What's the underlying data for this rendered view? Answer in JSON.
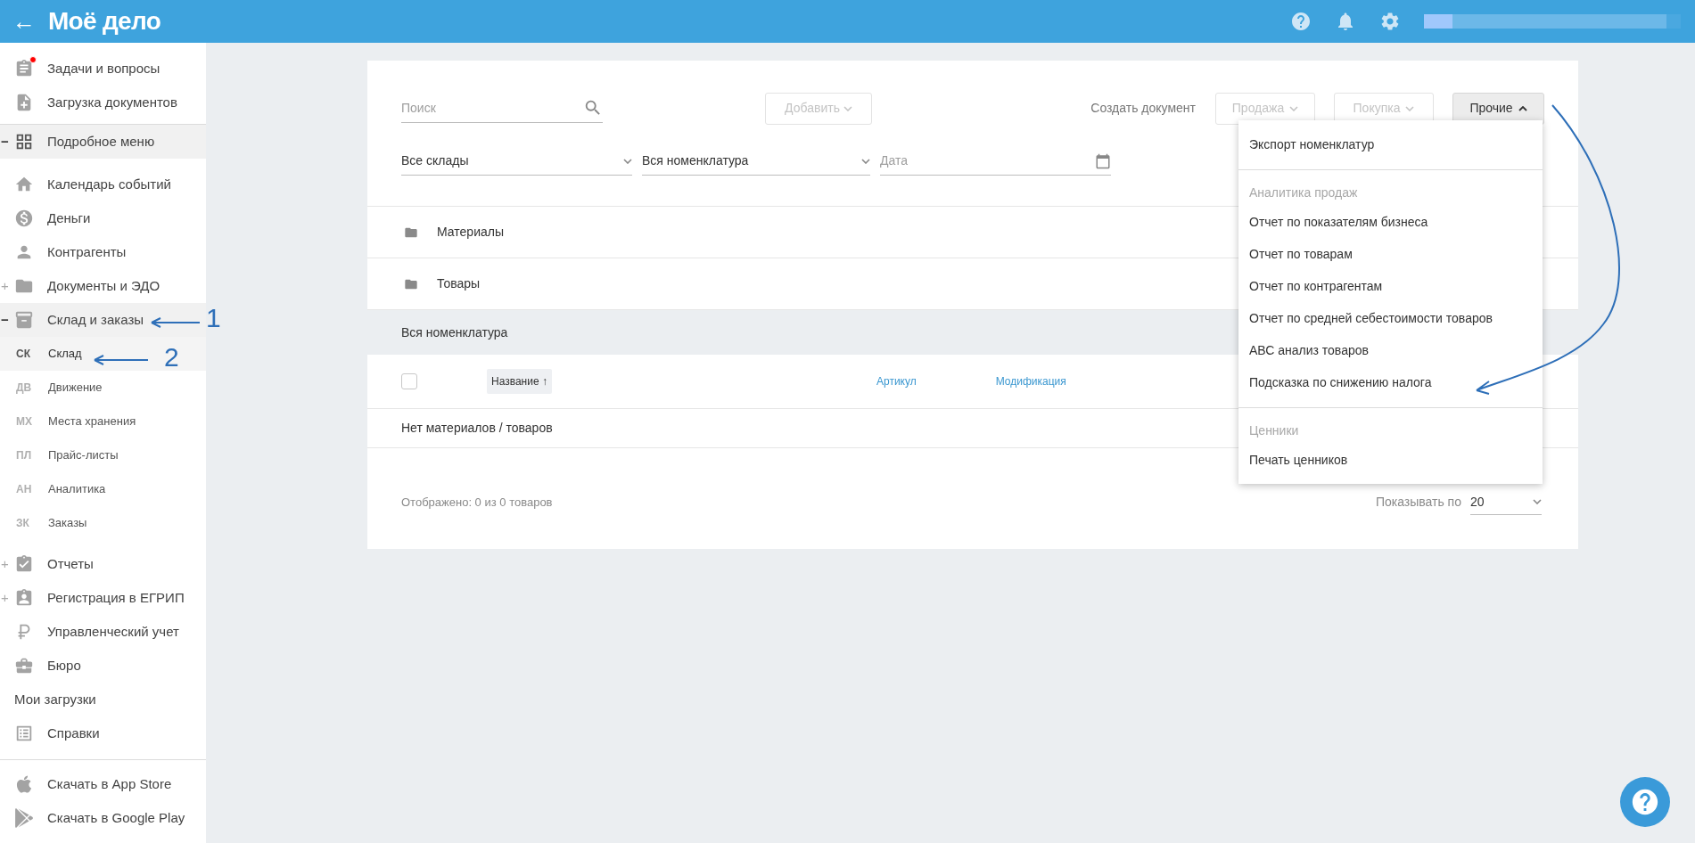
{
  "top_bar": {
    "back": "←",
    "logo": "Моё дело"
  },
  "sidebar": {
    "groups": [
      {
        "items": [
          {
            "label": "Задачи и вопросы",
            "unread": true
          },
          {
            "label": "Загрузка документов",
            "unread": false
          }
        ]
      },
      {
        "items": [
          {
            "label": "Подробное меню",
            "toggle": "−",
            "expanded": true
          }
        ]
      },
      {
        "items": [
          {
            "label": "Календарь событий"
          },
          {
            "label": "Деньги"
          },
          {
            "label": "Контрагенты"
          },
          {
            "label": "Документы и ЭДО",
            "toggle": "+",
            "expanded": false
          },
          {
            "label": "Склад и заказы",
            "toggle": "−",
            "expanded": true,
            "children": [
              {
                "abbr": "СК",
                "label": "Склад",
                "selected": true
              },
              {
                "abbr": "ДВ",
                "label": "Движение",
                "selected": false
              },
              {
                "abbr": "МХ",
                "label": "Места хранения",
                "selected": false
              },
              {
                "abbr": "ПЛ",
                "label": "Прайс-листы",
                "selected": false
              },
              {
                "abbr": "АН",
                "label": "Аналитика",
                "selected": false
              },
              {
                "abbr": "ЗК",
                "label": "Заказы",
                "selected": false
              }
            ]
          }
        ]
      },
      {
        "items": [
          {
            "label": "Отчеты",
            "toggle": "+",
            "expanded": false
          },
          {
            "label": "Регистрация в ЕГРИП",
            "toggle": "+",
            "expanded": false
          },
          {
            "label": "Управленческий учет"
          },
          {
            "label": "Бюро"
          },
          {
            "label": "Мои загрузки"
          },
          {
            "label": "Справки"
          }
        ]
      },
      {
        "items": [
          {
            "label": "Скачать в App Store"
          },
          {
            "label": "Скачать в Google Play"
          }
        ]
      }
    ]
  },
  "toolbar": {
    "search": {
      "placeholder": "Поиск"
    },
    "add": {
      "label": "Добавить",
      "disabled": true
    },
    "create_label": "Создать документ",
    "buttons": [
      {
        "label": "Продажа",
        "disabled": true,
        "open": false
      },
      {
        "label": "Покупка",
        "disabled": true,
        "open": false
      },
      {
        "label": "Прочие",
        "disabled": false,
        "open": true
      }
    ]
  },
  "filters": {
    "warehouse": "Все склады",
    "nomenclature": "Вся номенклатура",
    "date": {
      "placeholder": "Дата"
    }
  },
  "folders": [
    "Материалы",
    "Товары"
  ],
  "section_title": "Вся номенклатура",
  "table": {
    "select_all": {
      "checked": false
    },
    "columns": [
      {
        "label": "Название",
        "sorted": true,
        "sort_mark": "↑"
      },
      {
        "label": "Артикул",
        "sorted": false
      },
      {
        "label": "Модификация",
        "sorted": false
      }
    ],
    "empty": "Нет материалов / товаров"
  },
  "footer": {
    "shown": "Отображено: 0 из 0 товаров",
    "page_size_label": "Показывать по",
    "page_size": "20"
  },
  "menu": [
    {
      "kind": "item",
      "label": "Экспорт номенклатур"
    },
    {
      "kind": "divider"
    },
    {
      "kind": "header",
      "label": "Аналитика продаж"
    },
    {
      "kind": "item",
      "label": "Отчет по показателям бизнеса"
    },
    {
      "kind": "item",
      "label": "Отчет по товарам"
    },
    {
      "kind": "item",
      "label": "Отчет по контрагентам"
    },
    {
      "kind": "item",
      "label": "Отчет по средней себестоимости товаров"
    },
    {
      "kind": "item",
      "label": "АВС анализ товаров"
    },
    {
      "kind": "item",
      "label": "Подсказка по снижению налога"
    },
    {
      "kind": "divider"
    },
    {
      "kind": "header",
      "label": "Ценники"
    },
    {
      "kind": "item",
      "label": "Печать ценников"
    }
  ],
  "annotations": [
    {
      "label": "1"
    },
    {
      "label": "2"
    }
  ]
}
